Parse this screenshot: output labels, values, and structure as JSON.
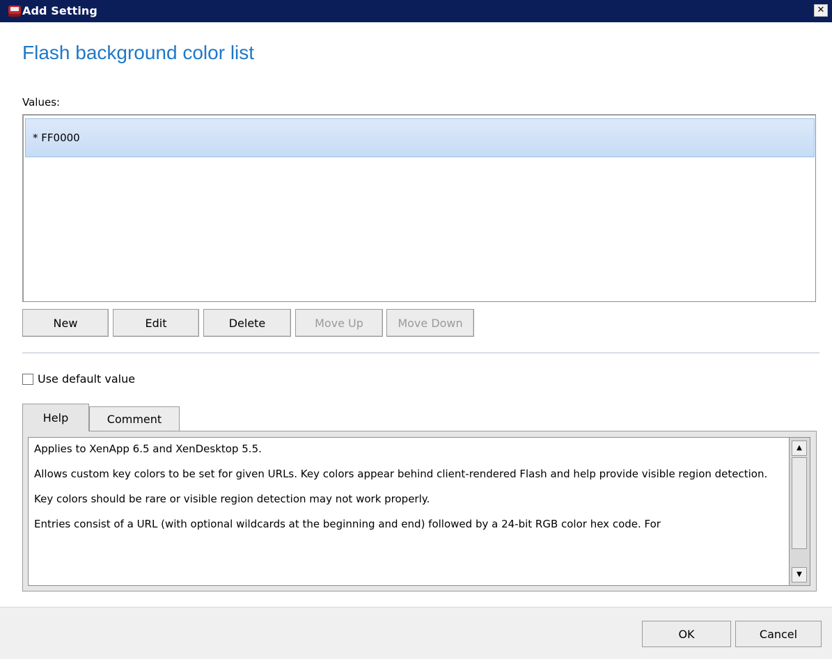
{
  "window": {
    "title": "Add Setting",
    "app_icon": "policy-settings-icon",
    "close_icon": "close-icon"
  },
  "page_title": "Flash background color list",
  "values_label": "Values:",
  "values_list": {
    "items": [
      "* FF0000"
    ],
    "selected_index": 0
  },
  "list_buttons": {
    "new": "New",
    "edit": "Edit",
    "delete": "Delete",
    "move_up": "Move Up",
    "move_down": "Move Down"
  },
  "use_default": {
    "label": "Use default value",
    "checked": false
  },
  "tabs": [
    {
      "label": "Help",
      "active": true
    },
    {
      "label": "Comment",
      "active": false
    }
  ],
  "help_text": [
    "Applies to XenApp 6.5 and XenDesktop 5.5.",
    "Allows custom key colors to be set for given URLs. Key colors appear behind client-rendered Flash and help provide visible region detection.",
    "Key colors should be rare or visible region detection may not work properly.",
    "Entries consist of a URL (with optional wildcards at the beginning and end) followed by a 24-bit RGB color hex code. For"
  ],
  "footer": {
    "ok": "OK",
    "cancel": "Cancel"
  },
  "colors": {
    "title_accent": "#1f78c8",
    "titlebar_bg": "#0c1e5a",
    "selection_bg": "#c6dcf6"
  }
}
